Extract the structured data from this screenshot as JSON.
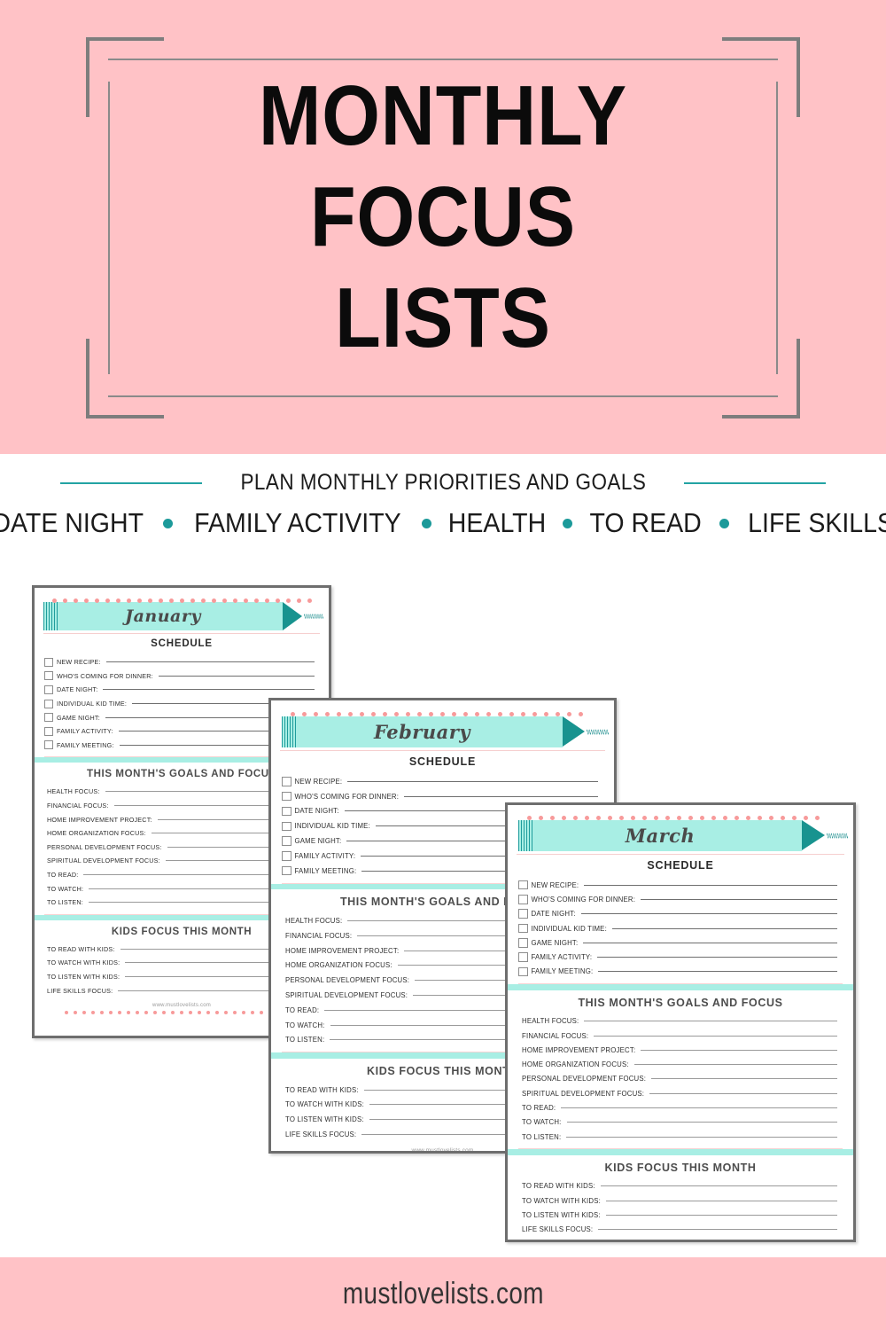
{
  "hero": {
    "title_lines": [
      "MONTHLY",
      "FOCUS",
      "LISTS"
    ],
    "background_color": "#ffc2c6",
    "frame_color": "#7d7d7d"
  },
  "subtitle": {
    "tagline": "PLAN MONTHLY PRIORITIES AND GOALS",
    "rule_color": "#23a3a3",
    "keywords": [
      "DATE NIGHT",
      "FAMILY ACTIVITY",
      "HEALTH",
      "TO READ",
      "LIFE SKILLS"
    ],
    "bullet_color": "#1c9a9a"
  },
  "planner": {
    "schedule_heading": "SCHEDULE",
    "goals_heading": "THIS MONTH'S GOALS AND FOCUS",
    "kids_heading": "KIDS FOCUS THIS MONTH",
    "schedule_items": [
      "NEW RECIPE:",
      "WHO'S COMING FOR DINNER:",
      "DATE NIGHT:",
      "INDIVIDUAL KID TIME:",
      "GAME NIGHT:",
      "FAMILY ACTIVITY:",
      "FAMILY MEETING:"
    ],
    "goals_items": [
      "HEALTH FOCUS:",
      "FINANCIAL FOCUS:",
      "HOME IMPROVEMENT PROJECT:",
      "HOME ORGANIZATION FOCUS:",
      "PERSONAL DEVELOPMENT FOCUS:",
      "SPIRITUAL DEVELOPMENT FOCUS:",
      "TO READ:",
      "TO WATCH:",
      "TO LISTEN:"
    ],
    "kids_items": [
      "TO READ WITH KIDS:",
      "TO WATCH WITH KIDS:",
      "TO LISTEN WITH KIDS:",
      "LIFE SKILLS FOCUS:"
    ],
    "card_site": "www.mustlovelists.com",
    "banner_color": "#a8eee4",
    "arrow_color": "#18938f",
    "dot_color": "#f79a9a"
  },
  "cards": [
    {
      "month": "January"
    },
    {
      "month": "February"
    },
    {
      "month": "March"
    }
  ],
  "footer": {
    "site": "mustlovelists.com",
    "background_color": "#ffc2c6"
  }
}
